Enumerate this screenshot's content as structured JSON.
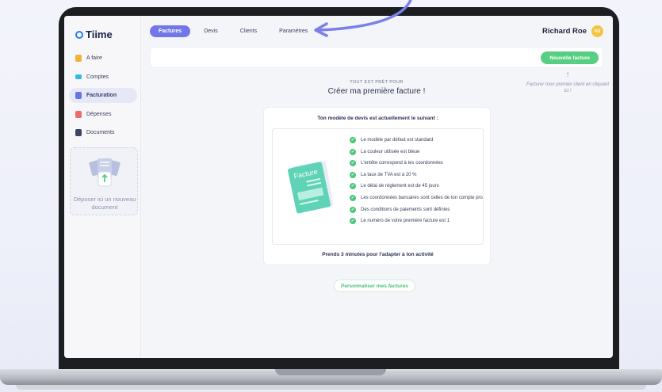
{
  "app": {
    "logo": "Tiime"
  },
  "tabs": [
    {
      "label": "Factures",
      "active": true
    },
    {
      "label": "Devis",
      "active": false
    },
    {
      "label": "Clients",
      "active": false
    },
    {
      "label": "Paramètres",
      "active": false
    }
  ],
  "user": {
    "name": "Richard Roe",
    "initials": "RR"
  },
  "sidebar": {
    "items": [
      {
        "label": "A faire",
        "icon": "todo-icon",
        "color": "#f3b23a"
      },
      {
        "label": "Comptes",
        "icon": "accounts-icon",
        "color": "#36b7e8"
      },
      {
        "label": "Facturation",
        "icon": "invoice-icon",
        "color": "#6b74e3",
        "active": true
      },
      {
        "label": "Dépenses",
        "icon": "expenses-icon",
        "color": "#ee6b6b"
      },
      {
        "label": "Documents",
        "icon": "documents-icon",
        "color": "#3d4566"
      }
    ],
    "drop_text": "Déposer ici un nouveau document"
  },
  "toolbar": {
    "new_invoice": "Nouvelle facture"
  },
  "hint": {
    "text": "Facturer mon premier client en cliquant ici !"
  },
  "main": {
    "kicker": "TOUT EST PRÊT POUR",
    "headline": "Créer ma première facture !",
    "card_title": "Ton modèle de devis est actuellement le suivant :",
    "invoice_label": "Facture",
    "checks": [
      "Le modèle par défaut est standard",
      "La couleur utilisée est bleue",
      "L'entête correspond à tes coordonnées",
      "La taux de TVA est à 20 %",
      "Le délai de règlement est de 45 jours",
      "Les coordonnées bancaires sont celles de ton compte pro",
      "Des conditions de paiements sont définies",
      "Le numéro de votre première facture est 1"
    ],
    "card_footer": "Prends 3 minutes pour l'adapter à ton activité",
    "customize_button": "Personnaliser mes factures"
  },
  "colors": {
    "accent": "#7177e6",
    "success": "#57cf82",
    "arrow": "#7c7fe9"
  }
}
